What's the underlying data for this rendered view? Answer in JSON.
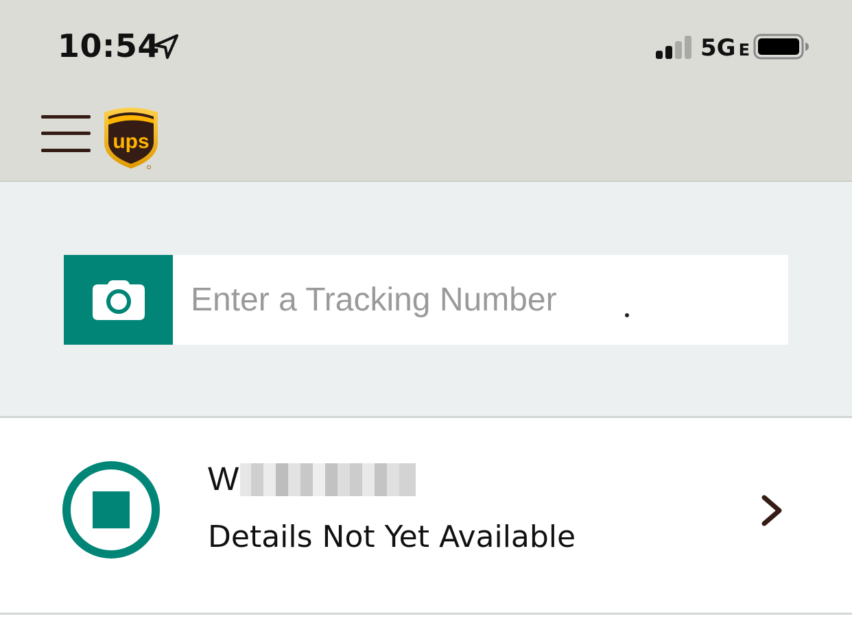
{
  "status_bar": {
    "time": "10:54",
    "location_icon": "location-arrow-icon",
    "signal_icon": "cellular-signal-icon",
    "network": "5G",
    "network_suffix": "E",
    "battery_icon": "battery-icon"
  },
  "header": {
    "menu_icon": "hamburger-menu-icon",
    "logo": "ups-logo",
    "logo_text": "ups"
  },
  "search": {
    "camera_icon": "camera-icon",
    "placeholder": "Enter a Tracking Number",
    "value": ""
  },
  "shipments": [
    {
      "tracking_prefix": "W",
      "status": "Details Not Yet Available",
      "status_icon": "stop-circle-icon",
      "chevron_icon": "chevron-right-icon"
    }
  ],
  "colors": {
    "header_bg": "#dcdcd7",
    "accent_teal": "#008577",
    "ups_brown": "#351c15",
    "ups_gold": "#ffb500",
    "search_bg": "#edf0f0"
  }
}
